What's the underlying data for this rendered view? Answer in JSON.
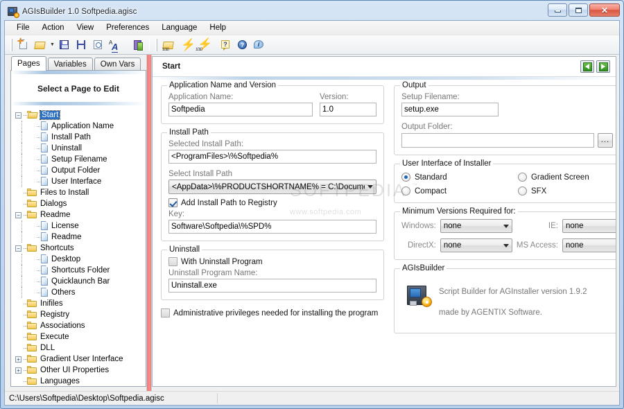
{
  "window": {
    "title": "AGIsBuilder 1.0 Softpedia.agisc",
    "app_icon": "installer-builder-icon",
    "minimize_label": "Minimize",
    "maximize_label": "Maximize",
    "close_label": "Close"
  },
  "menubar": {
    "items": [
      {
        "label": "File"
      },
      {
        "label": "Action"
      },
      {
        "label": "View"
      },
      {
        "label": "Preferences"
      },
      {
        "label": "Language"
      },
      {
        "label": "Help"
      }
    ]
  },
  "toolbar": {
    "buttons": [
      {
        "name": "new-file-icon",
        "tooltip": "New"
      },
      {
        "name": "open-file-icon",
        "tooltip": "Open"
      },
      {
        "name": "open-dropdown-arrow",
        "tooltip": "Recent files"
      },
      {
        "name": "save-icon",
        "tooltip": "Save"
      },
      {
        "name": "save-as-icon",
        "tooltip": "Save As"
      },
      {
        "name": "preview-icon",
        "tooltip": "Preview"
      },
      {
        "name": "font-icon",
        "tooltip": "Font"
      },
      {
        "name": "exit-icon",
        "tooltip": "Exit"
      },
      {
        "name": "open-script-folder-icon",
        "tooltip": "Open script folder"
      },
      {
        "name": "build-icon",
        "tooltip": "Build"
      },
      {
        "name": "build-run-icon",
        "tooltip": "Build and run"
      },
      {
        "name": "question-icon",
        "tooltip": "Context help"
      },
      {
        "name": "help-icon",
        "tooltip": "Help"
      },
      {
        "name": "about-icon",
        "tooltip": "About"
      }
    ]
  },
  "sidebar": {
    "tabs": [
      {
        "label": "Pages",
        "active": true
      },
      {
        "label": "Variables",
        "active": false
      },
      {
        "label": "Own Vars",
        "active": false
      }
    ],
    "header": "Select a Page to Edit",
    "tree": [
      {
        "label": "Start",
        "type": "folder-open",
        "depth": 0,
        "expander": "minus",
        "selected": true
      },
      {
        "label": "Application Name",
        "type": "page",
        "depth": 1,
        "expander": "none",
        "selected": false
      },
      {
        "label": "Install Path",
        "type": "page",
        "depth": 1,
        "expander": "none",
        "selected": false
      },
      {
        "label": "Uninstall",
        "type": "page",
        "depth": 1,
        "expander": "none",
        "selected": false
      },
      {
        "label": "Setup Filename",
        "type": "page",
        "depth": 1,
        "expander": "none",
        "selected": false
      },
      {
        "label": "Output Folder",
        "type": "page",
        "depth": 1,
        "expander": "none",
        "selected": false
      },
      {
        "label": "User Interface",
        "type": "page",
        "depth": 1,
        "expander": "none",
        "selected": false
      },
      {
        "label": "Files to Install",
        "type": "folder",
        "depth": 0,
        "expander": "none",
        "selected": false
      },
      {
        "label": "Dialogs",
        "type": "folder",
        "depth": 0,
        "expander": "none",
        "selected": false
      },
      {
        "label": "Readme",
        "type": "folder",
        "depth": 0,
        "expander": "minus",
        "selected": false
      },
      {
        "label": "License",
        "type": "page",
        "depth": 1,
        "expander": "none",
        "selected": false
      },
      {
        "label": "Readme",
        "type": "page",
        "depth": 1,
        "expander": "none",
        "selected": false
      },
      {
        "label": "Shortcuts",
        "type": "folder",
        "depth": 0,
        "expander": "minus",
        "selected": false
      },
      {
        "label": "Desktop",
        "type": "page",
        "depth": 1,
        "expander": "none",
        "selected": false
      },
      {
        "label": "Shortcuts Folder",
        "type": "page",
        "depth": 1,
        "expander": "none",
        "selected": false
      },
      {
        "label": "Quicklaunch Bar",
        "type": "page",
        "depth": 1,
        "expander": "none",
        "selected": false
      },
      {
        "label": "Others",
        "type": "page",
        "depth": 1,
        "expander": "none",
        "selected": false
      },
      {
        "label": "Inifiles",
        "type": "folder",
        "depth": 0,
        "expander": "none",
        "selected": false
      },
      {
        "label": "Registry",
        "type": "folder",
        "depth": 0,
        "expander": "none",
        "selected": false
      },
      {
        "label": "Associations",
        "type": "folder",
        "depth": 0,
        "expander": "none",
        "selected": false
      },
      {
        "label": "Execute",
        "type": "folder",
        "depth": 0,
        "expander": "none",
        "selected": false
      },
      {
        "label": "DLL",
        "type": "folder",
        "depth": 0,
        "expander": "none",
        "selected": false
      },
      {
        "label": "Gradient User Interface",
        "type": "folder",
        "depth": 0,
        "expander": "plus",
        "selected": false
      },
      {
        "label": "Other UI Properties",
        "type": "folder",
        "depth": 0,
        "expander": "plus",
        "selected": false
      },
      {
        "label": "Languages",
        "type": "folder",
        "depth": 0,
        "expander": "none",
        "selected": false
      }
    ]
  },
  "page": {
    "title": "Start",
    "nav_prev": "Previous page",
    "nav_next": "Next page"
  },
  "app_name_group": {
    "title": "Application Name and Version",
    "name_label": "Application Name:",
    "name_value": "Softpedia",
    "version_label": "Version:",
    "version_value": "1.0"
  },
  "install_path_group": {
    "title": "Install Path",
    "selected_label": "Selected Install Path:",
    "selected_value": "<ProgramFiles>\\%Softpedia%",
    "select_label": "Select Install Path",
    "select_value": "<AppData>\\%PRODUCTSHORTNAME% = C:\\Documer",
    "registry_checkbox_label": "Add Install Path to Registry",
    "registry_checked": true,
    "key_label": "Key:",
    "key_value": "Software\\Softpedia\\%SPD%"
  },
  "uninstall_group": {
    "title": "Uninstall",
    "with_uninstall_label": "With Uninstall Program",
    "with_uninstall_checked": false,
    "program_name_label": "Uninstall Program Name:",
    "program_name_value": "Uninstall.exe"
  },
  "admin_option": {
    "label": "Administrative privileges needed for installing the program",
    "checked": false
  },
  "output_group": {
    "title": "Output",
    "setup_filename_label": "Setup Filename:",
    "setup_filename_value": "setup.exe",
    "output_folder_label": "Output Folder:",
    "output_folder_value": "",
    "browse_button_label": "...",
    "folder_button_label": "open-folder-icon"
  },
  "ui_group": {
    "title": "User Interface of Installer",
    "options": [
      {
        "label": "Standard",
        "selected": true
      },
      {
        "label": "Gradient Screen",
        "selected": false
      },
      {
        "label": "Compact",
        "selected": false
      },
      {
        "label": "SFX",
        "selected": false
      }
    ]
  },
  "versions_group": {
    "title": "Minimum Versions Required for:",
    "fields": [
      {
        "label": "Windows:",
        "value": "none"
      },
      {
        "label": "IE:",
        "value": "none"
      },
      {
        "label": "DirectX:",
        "value": "none"
      },
      {
        "label": "MS Access:",
        "value": "none"
      }
    ]
  },
  "about_group": {
    "title": "AGIsBuilder",
    "line1": "Script Builder for AGInstaller version 1.9.2",
    "line2": "made by AGENTIX Software.",
    "icon": "agisbuilder-logo-icon"
  },
  "watermark": {
    "main": "SOFTPEDIA",
    "tm": "™",
    "sub": "www.softpedia.com"
  },
  "statusbar": {
    "path": "C:\\Users\\Softpedia\\Desktop\\Softpedia.agisc"
  },
  "colors": {
    "accent_blue": "#2a6fc4",
    "splitter_red": "#fb7f7f",
    "nav_green": "#2f8f20",
    "title_bar": "#c3d8ef"
  }
}
